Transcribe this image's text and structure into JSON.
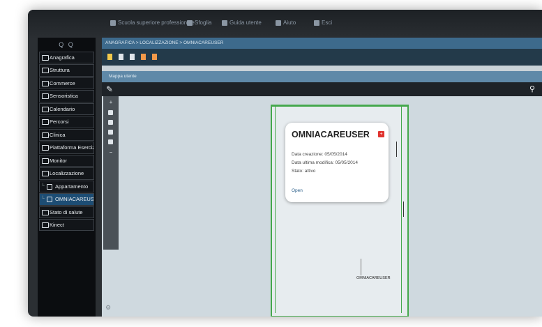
{
  "topbar": {
    "items": [
      {
        "label": "Scuola superiore professionale",
        "icon": "user-icon"
      },
      {
        "label": "Sfoglia",
        "icon": "list-icon"
      },
      {
        "label": "Guida utente",
        "icon": "book-icon"
      },
      {
        "label": "Aiuto",
        "icon": "help-icon"
      },
      {
        "label": "Esci",
        "icon": "logout-icon"
      }
    ]
  },
  "sidebar": {
    "search_icons": "Q Q",
    "items": [
      {
        "label": "Anagrafica",
        "type": "root"
      },
      {
        "label": "Struttura",
        "type": "root"
      },
      {
        "label": "Commerce",
        "type": "root"
      },
      {
        "label": "Sensoristica",
        "type": "root"
      },
      {
        "label": "Calendario",
        "type": "root"
      },
      {
        "label": "Percorsi",
        "type": "root"
      },
      {
        "label": "Clinica",
        "type": "root"
      },
      {
        "label": "Piattaforma Esercizi",
        "type": "root"
      },
      {
        "label": "Monitor",
        "type": "root"
      },
      {
        "label": "Localizzazione",
        "type": "root"
      },
      {
        "label": "Appartamento",
        "type": "sub"
      },
      {
        "label": "OMNIACAREUSER",
        "type": "sub",
        "active": true
      },
      {
        "label": "Stato di salute",
        "type": "root"
      },
      {
        "label": "Kinect",
        "type": "root"
      }
    ]
  },
  "breadcrumb": "ANAGRAFICA > LOCALIZZAZIONE > OMNIACAREUSER",
  "toolbar": {
    "colors": [
      "#f2c94c",
      "#dfe5ea",
      "#dfe5ea",
      "#f2994a",
      "#f2994a"
    ]
  },
  "section": {
    "title": "Mappa utente"
  },
  "map_controls": {
    "zoom_in": "+",
    "zoom_out": "−"
  },
  "popup": {
    "title": "OMNIACAREUSER",
    "close": "+",
    "rows": [
      "Data creazione: 05/05/2014",
      "Data ultima modifica: 05/05/2014",
      "Stato: attivo"
    ],
    "open_label": "Open"
  },
  "marker": {
    "label": "OMNIACAREUSER"
  },
  "colors": {
    "accent": "#3d6a8c",
    "active_item": "#1d4d74",
    "wall": "#45a84d",
    "close": "#e0342f"
  }
}
